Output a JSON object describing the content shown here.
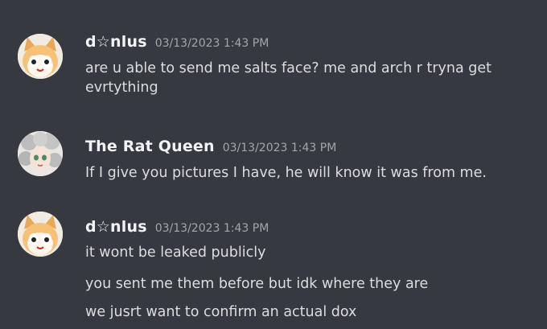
{
  "messages": [
    {
      "author": "d☆nlus",
      "timestamp": "03/13/2023 1:43 PM",
      "avatar_icon": "cat-avatar-icon",
      "lines": [
        "are u able to send me salts face? me and arch r tryna get evrtything"
      ]
    },
    {
      "author": "The Rat Queen",
      "timestamp": "03/13/2023 1:43 PM",
      "avatar_icon": "grey-hair-avatar-icon",
      "lines": [
        "If I give you pictures I have, he will know it was from me."
      ]
    },
    {
      "author": "d☆nlus",
      "timestamp": "03/13/2023 1:43 PM",
      "avatar_icon": "cat-avatar-icon",
      "lines": [
        "it wont be leaked publicly",
        "you sent me them before but idk where they are",
        "we jusrt want to confirm an actual dox"
      ]
    }
  ],
  "colors": {
    "background": "#36393f",
    "username": "#f2f3f5",
    "timestamp": "#a3a6aa",
    "message_text": "#dcddde"
  }
}
